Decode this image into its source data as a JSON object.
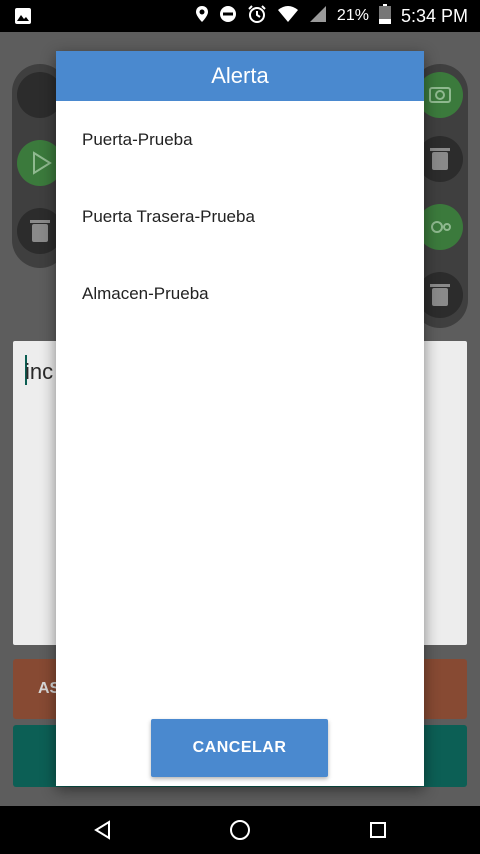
{
  "status_bar": {
    "battery_percent": "21%",
    "time": "5:34 PM"
  },
  "background_app": {
    "text_value": "inc",
    "orange_button_label": "AS"
  },
  "dialog": {
    "title": "Alerta",
    "options": [
      "Puerta-Prueba",
      "Puerta Trasera-Prueba",
      "Almacen-Prueba"
    ],
    "cancel_label": "CANCELAR"
  },
  "icons": {
    "status_left": "image-icon",
    "status_right": [
      "location-icon",
      "do-not-disturb-icon",
      "alarm-icon",
      "wifi-icon",
      "signal-icon",
      "battery-icon"
    ],
    "nav": [
      "back-icon",
      "home-icon",
      "recents-icon"
    ]
  }
}
